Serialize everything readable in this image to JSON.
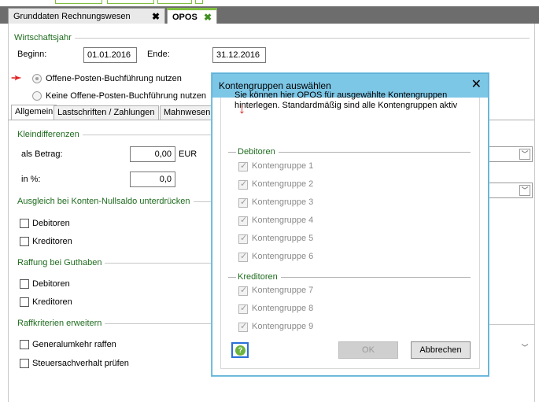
{
  "tabs": {
    "t1": {
      "label": "Grunddaten Rechnungswesen",
      "close": "✖"
    },
    "t2": {
      "label": "OPOS",
      "close": "✖"
    }
  },
  "wirtschaftsjahr": {
    "header": "Wirtschaftsjahr",
    "beginn_label": "Beginn:",
    "beginn_value": "01.01.2016",
    "ende_label": "Ende:",
    "ende_value": "31.12.2016"
  },
  "radios": {
    "nutzen": "Offene-Posten-Buchführung nutzen",
    "keine": "Keine Offene-Posten-Buchführung nutzen"
  },
  "subtabs": [
    "Allgemein",
    "Lastschriften / Zahlungen",
    "Mahnwesen"
  ],
  "kleindifferenzen": {
    "header": "Kleindifferenzen",
    "betrag_label": "als Betrag:",
    "betrag_value": "0,00",
    "currency": "EUR",
    "prozent_label": "in %:",
    "prozent_value": "0,0"
  },
  "ausgleich": {
    "header": "Ausgleich bei Konten-Nullsaldo unterdrücken",
    "debitoren": "Debitoren",
    "kreditoren": "Kreditoren"
  },
  "raffung": {
    "header": "Raffung bei Guthaben",
    "debitoren": "Debitoren",
    "kreditoren": "Kreditoren"
  },
  "raffkriterien": {
    "header": "Raffkriterien erweitern",
    "generalumkehr": "Generalumkehr raffen",
    "steuersachverhalt": "Steuersachverhalt prüfen"
  },
  "dialog": {
    "title": "Kontengruppen auswählen",
    "close": "✕",
    "text": "Sie können hier OPOS für ausgewählte Kontengruppen hinterlegen. Standardmäßig sind alle Kontengruppen aktiv",
    "debitoren_header": "Debitoren",
    "kreditoren_header": "Kreditoren",
    "debitoren_items": [
      "Kontengruppe 1",
      "Kontengruppe 2",
      "Kontengruppe 3",
      "Kontengruppe 4",
      "Kontengruppe 5",
      "Kontengruppe 6"
    ],
    "kreditoren_items": [
      "Kontengruppe 7",
      "Kontengruppe 8",
      "Kontengruppe 9"
    ],
    "ok_label": "OK",
    "cancel_label": "Abbrechen",
    "help_glyph": "?"
  },
  "colors": {
    "accent_green": "#7fbf3f",
    "group_header_green": "#1e6b1e",
    "dialog_title_bg": "#7cc6e6",
    "arrow_red": "#e02020"
  },
  "icons": {
    "annotation_arrow_left": "arrow-right-icon",
    "annotation_arrow_down": "arrow-down-icon",
    "combo_arrow": "chevron-down-icon",
    "help": "help-icon"
  }
}
